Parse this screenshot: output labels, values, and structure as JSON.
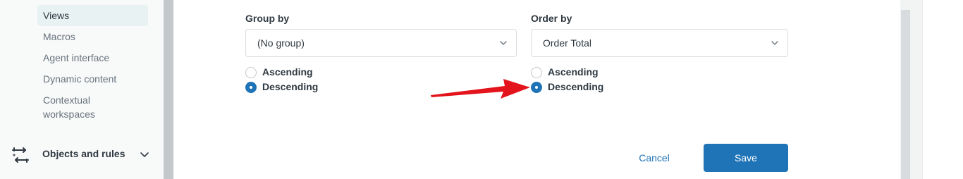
{
  "sidebar": {
    "items": [
      {
        "label": "Views",
        "active": true
      },
      {
        "label": "Macros",
        "active": false
      },
      {
        "label": "Agent interface",
        "active": false
      },
      {
        "label": "Dynamic content",
        "active": false
      },
      {
        "label": "Contextual workspaces",
        "active": false
      }
    ],
    "group": {
      "label": "Objects and rules",
      "icon": "objects-rules-icon"
    }
  },
  "form": {
    "group_by": {
      "label": "Group by",
      "value": "(No group)",
      "options": {
        "ascending": "Ascending",
        "descending": "Descending"
      },
      "selected": "descending"
    },
    "order_by": {
      "label": "Order by",
      "value": "Order Total",
      "options": {
        "ascending": "Ascending",
        "descending": "Descending"
      },
      "selected": "descending"
    }
  },
  "actions": {
    "cancel": "Cancel",
    "save": "Save"
  },
  "colors": {
    "accent": "#1f73b7",
    "annotation_arrow": "#e3141b",
    "active_bg": "#e9f2f2"
  }
}
